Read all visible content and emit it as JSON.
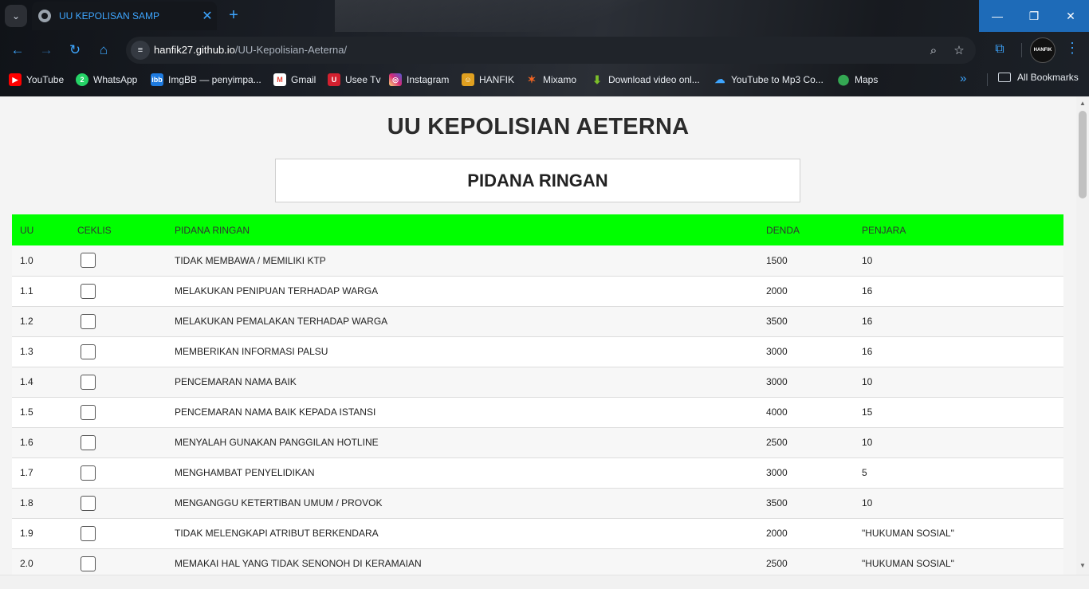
{
  "browser": {
    "tab_title": "UU KEPOLISAN SAMP",
    "url_host": "hanfik27.github.io",
    "url_path": "/UU-Kepolisian-Aeterna/",
    "profile_label": "HANFIK",
    "bookmarks": [
      {
        "label": "YouTube",
        "icon": "youtube-icon",
        "color": "#ff0000"
      },
      {
        "label": "WhatsApp",
        "icon": "whatsapp-icon",
        "color": "#25d366"
      },
      {
        "label": "ImgBB — penyimpa...",
        "icon": "imgbb-icon",
        "color": "#1e7be0"
      },
      {
        "label": "Gmail",
        "icon": "gmail-icon",
        "color": "#ea4335"
      },
      {
        "label": "Usee Tv",
        "icon": "useetv-icon",
        "color": "#d3202f"
      },
      {
        "label": "Instagram",
        "icon": "instagram-icon",
        "color": "#d62976"
      },
      {
        "label": "HANFIK",
        "icon": "hanfik-icon",
        "color": "#e0a020"
      },
      {
        "label": "Mixamo",
        "icon": "mixamo-icon",
        "color": "#f26522"
      },
      {
        "label": "Download video onl...",
        "icon": "download-icon",
        "color": "#7cbf2a"
      },
      {
        "label": "YouTube to Mp3 Co...",
        "icon": "cloud-download-icon",
        "color": "#3ea6ff"
      },
      {
        "label": "Maps",
        "icon": "maps-icon",
        "color": "#34a853"
      }
    ],
    "all_bookmarks": "All Bookmarks"
  },
  "page": {
    "title": "UU KEPOLISIAN AETERNA",
    "section": "PIDANA RINGAN"
  },
  "table": {
    "headers": {
      "uu": "UU",
      "ceklis": "CEKLIS",
      "pidana": "PIDANA RINGAN",
      "denda": "DENDA",
      "penjara": "PENJARA"
    },
    "rows": [
      {
        "uu": "1.0",
        "pidana": "TIDAK MEMBAWA / MEMILIKI KTP",
        "denda": "1500",
        "penjara": "10"
      },
      {
        "uu": "1.1",
        "pidana": "MELAKUKAN PENIPUAN TERHADAP WARGA",
        "denda": "2000",
        "penjara": "16"
      },
      {
        "uu": "1.2",
        "pidana": "MELAKUKAN PEMALAKAN TERHADAP WARGA",
        "denda": "3500",
        "penjara": "16"
      },
      {
        "uu": "1.3",
        "pidana": "MEMBERIKAN INFORMASI PALSU",
        "denda": "3000",
        "penjara": "16"
      },
      {
        "uu": "1.4",
        "pidana": "PENCEMARAN NAMA BAIK",
        "denda": "3000",
        "penjara": "10"
      },
      {
        "uu": "1.5",
        "pidana": "PENCEMARAN NAMA BAIK KEPADA ISTANSI",
        "denda": "4000",
        "penjara": "15"
      },
      {
        "uu": "1.6",
        "pidana": "MENYALAH GUNAKAN PANGGILAN HOTLINE",
        "denda": "2500",
        "penjara": "10"
      },
      {
        "uu": "1.7",
        "pidana": "MENGHAMBAT PENYELIDIKAN",
        "denda": "3000",
        "penjara": "5"
      },
      {
        "uu": "1.8",
        "pidana": "MENGANGGU KETERTIBAN UMUM / PROVOK",
        "denda": "3500",
        "penjara": "10"
      },
      {
        "uu": "1.9",
        "pidana": "TIDAK MELENGKAPI ATRIBUT BERKENDARA",
        "denda": "2000",
        "penjara": "\"HUKUMAN SOSIAL\""
      },
      {
        "uu": "2.0",
        "pidana": "MEMAKAI HAL YANG TIDAK SENONOH DI KERAMAIAN",
        "denda": "2500",
        "penjara": "\"HUKUMAN SOSIAL\""
      }
    ]
  }
}
